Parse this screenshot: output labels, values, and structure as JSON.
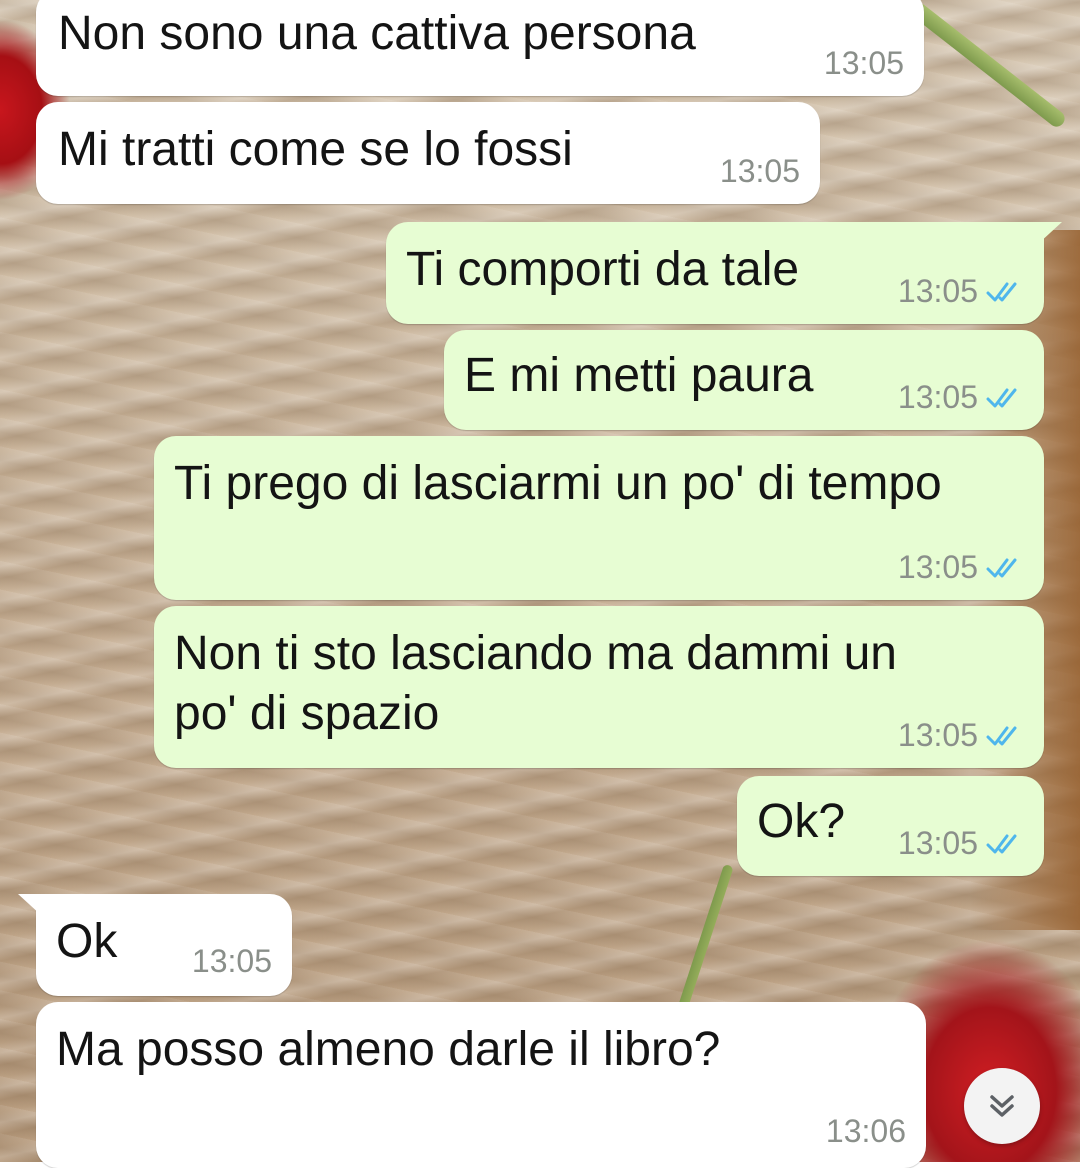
{
  "messages": [
    {
      "direction": "in",
      "text": "Non sono una cattiva persona",
      "time": "13:05"
    },
    {
      "direction": "in",
      "text": "Mi tratti come se lo fossi",
      "time": "13:05"
    },
    {
      "direction": "out",
      "text": "Ti comporti da tale",
      "time": "13:05",
      "status": "read"
    },
    {
      "direction": "out",
      "text": "E mi metti paura",
      "time": "13:05",
      "status": "read"
    },
    {
      "direction": "out",
      "text": "Ti prego di lasciarmi un po' di tempo",
      "time": "13:05",
      "status": "read"
    },
    {
      "direction": "out",
      "text": "Non ti sto lasciando ma dammi un\npo' di spazio",
      "time": "13:05",
      "status": "read"
    },
    {
      "direction": "out",
      "text": "Ok?",
      "time": "13:05",
      "status": "read"
    },
    {
      "direction": "in",
      "text": "Ok",
      "time": "13:05"
    },
    {
      "direction": "in",
      "text": "Ma posso almeno darle il libro?",
      "time": "13:06"
    }
  ],
  "icons": {
    "read_ticks": "double-check-icon",
    "scroll_down": "chevron-double-down-icon"
  },
  "colors": {
    "incoming_bubble": "#ffffff",
    "outgoing_bubble": "#e7fdd3",
    "read_ticks": "#4fb6ec",
    "timestamp": "#8a8f8a"
  }
}
